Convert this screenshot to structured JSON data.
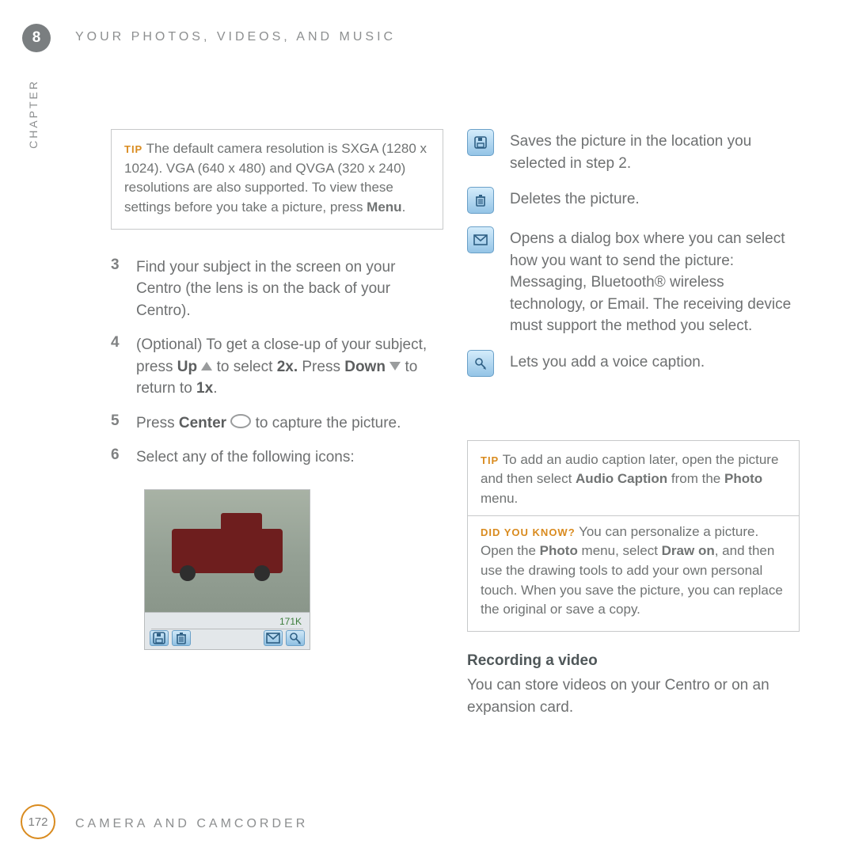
{
  "chapter": {
    "number": "8",
    "label": "CHAPTER"
  },
  "header": "YOUR PHOTOS, VIDEOS, AND MUSIC",
  "tip1": {
    "label": "TIP",
    "text_a": " The default camera resolution is SXGA (1280 x 1024). VGA (640 x 480) and QVGA (320 x 240) resolutions are also supported. To view these settings before you take a picture, press ",
    "bold": "Menu",
    "tail": "."
  },
  "steps": [
    {
      "n": "3",
      "text": "Find your subject in the screen on your Centro (the lens is on the back of your Centro)."
    },
    {
      "n": "4",
      "pre": "(Optional)  To get a close-up of your subject, press ",
      "up": "Up",
      "mid_a": " to select ",
      "x2": "2x.",
      "mid_b": " Press ",
      "down": "Down",
      "mid_c": " to return to ",
      "x1": "1x",
      "end": "."
    },
    {
      "n": "5",
      "pre": "Press ",
      "center": "Center",
      "post": " to capture the picture."
    },
    {
      "n": "6",
      "text": "Select any of the following icons:"
    }
  ],
  "preview": {
    "size": "171K"
  },
  "icons": [
    {
      "name": "save-icon",
      "desc": "Saves the picture in the location you selected in step 2."
    },
    {
      "name": "trash-icon",
      "desc": "Deletes the picture."
    },
    {
      "name": "envelope-icon",
      "desc": "Opens a dialog box where you can select how you want to send the picture: Messaging, Bluetooth® wireless technology, or Email. The receiving device must support the method you select."
    },
    {
      "name": "mic-icon",
      "desc": "Lets you add a voice caption."
    }
  ],
  "tip2": {
    "label": "TIP",
    "text_a": " To add an audio caption later, open the picture and then select ",
    "b1": "Audio Caption",
    "text_b": " from the ",
    "b2": "Photo",
    "text_c": " menu."
  },
  "dyk": {
    "label": "DID YOU KNOW?",
    "text_a": " You can personalize a picture. Open the ",
    "b1": "Photo",
    "text_b": " menu, select ",
    "b2": "Draw on",
    "text_c": ", and then use the drawing tools to add your own personal touch. When you save the picture, you can replace the original or save a copy."
  },
  "section": {
    "title": "Recording a video",
    "para": "You can store videos on your Centro or on an expansion card."
  },
  "footer": {
    "page": "172",
    "text": "CAMERA AND CAMCORDER"
  },
  "icon_svg": {
    "save": "<svg width='16' height='16' viewBox='0 0 16 16'><rect x='1' y='1' width='14' height='14' rx='2' fill='none' stroke='#2e5f84' stroke-width='1.6'/><rect x='4' y='9' width='8' height='5' fill='none' stroke='#2e5f84' stroke-width='1.4'/><rect x='5' y='2' width='5' height='4' fill='#2e5f84'/></svg>",
    "trash": "<svg width='16' height='16' viewBox='0 0 16 16'><rect x='3' y='4' width='10' height='11' rx='1' fill='none' stroke='#2e5f84' stroke-width='1.6'/><line x1='6' y1='6' x2='6' y2='13' stroke='#2e5f84' stroke-width='1.2'/><line x1='8' y1='6' x2='8' y2='13' stroke='#2e5f84' stroke-width='1.2'/><line x1='10' y1='6' x2='10' y2='13' stroke='#2e5f84' stroke-width='1.2'/><line x1='2' y1='4' x2='14' y2='4' stroke='#2e5f84' stroke-width='1.6'/><rect x='6' y='1' width='4' height='2' fill='#2e5f84'/></svg>",
    "env": "<svg width='18' height='14' viewBox='0 0 18 14'><rect x='1' y='1' width='16' height='12' fill='none' stroke='#2e5f84' stroke-width='1.6'/><polyline points='1,1 9,8 17,1' fill='none' stroke='#2e5f84' stroke-width='1.6'/></svg>",
    "mic": "<svg width='16' height='16' viewBox='0 0 16 16'><circle cx='6' cy='6' r='4' fill='none' stroke='#2e5f84' stroke-width='1.6'/><line x1='9' y1='9' x2='14' y2='14' stroke='#2e5f84' stroke-width='1.6'/><path d='M11 14 l3 -1 l1 3 z' fill='#2e5f84'/></svg>"
  }
}
